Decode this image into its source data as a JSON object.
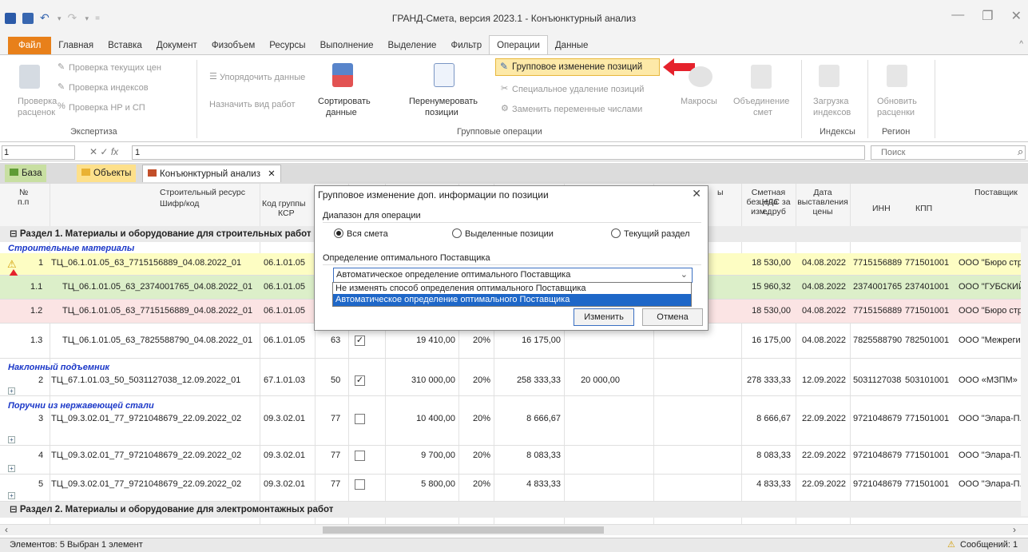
{
  "app": {
    "title": "ГРАНД-Смета, версия 2023.1 - Конъюнктурный анализ"
  },
  "menu": [
    "Файл",
    "Главная",
    "Вставка",
    "Документ",
    "Физобъем",
    "Ресурсы",
    "Выполнение",
    "Выделение",
    "Фильтр",
    "Операции",
    "Данные"
  ],
  "ribbon": {
    "check_prices": "Проверка текущих цен",
    "check_indexes": "Проверка индексов",
    "check_np": "Проверка НР и СП",
    "check_rates_1": "Проверка",
    "check_rates_2": "расценок",
    "group_expertise": "Экспертиза",
    "order_data": "Упорядочить данные",
    "assign_work": "Назначить вид работ",
    "sort_1": "Сортировать",
    "sort_2": "данные",
    "renumber_1": "Перенумеровать",
    "renumber_2": "позиции",
    "group_change": "Групповое изменение позиций",
    "special_delete": "Специальное удаление позиций",
    "replace_vars": "Заменить переменные числами",
    "group_ops": "Групповые операции",
    "macros": "Макросы",
    "merge_1": "Объединение",
    "merge_2": "смет",
    "load_1": "Загрузка",
    "load_2": "индексов",
    "group_indexes": "Индексы",
    "update_1": "Обновить",
    "update_2": "расценки",
    "group_region": "Регион"
  },
  "formula": {
    "cell": "1",
    "value": "1",
    "search_placeholder": "Поиск"
  },
  "tabs": {
    "base": "База",
    "objects": "Объекты",
    "analysis": "Конъюнктурный анализ"
  },
  "headers": {
    "num_1": "№",
    "num_2": "п.п",
    "resource": "Строительный ресурс",
    "code": "Шифр/код",
    "ksr_1": "Код группы",
    "ksr_2": "КСР",
    "units": "ы",
    "price_1": "Сметная цена",
    "price_2": "без НДС за ед.",
    "price_3": "изм., руб",
    "date_1": "Дата",
    "date_2": "выставления",
    "date_3": "цены",
    "supplier": "Поставщик",
    "inn": "ИНН",
    "kpp": "КПП"
  },
  "sections": {
    "s1": "Раздел 1. Материалы и оборудование для строительных работ",
    "s2": "Раздел 2. Материалы и оборудование для электромонтажных работ"
  },
  "groups": {
    "g1": "Строительные материалы",
    "g2": "Наклонный подъемник",
    "g3": "Поручни из нержавеющей стали"
  },
  "rows": [
    {
      "n": "1",
      "code": "ТЦ_06.1.01.05_63_7715156889_04.08.2022_01",
      "ksr": "06.1.01.05",
      "price": "18 530,00",
      "date": "04.08.2022",
      "inn": "7715156889",
      "kpp": "771501001",
      "sup": "ООО \"Бюро стр"
    },
    {
      "n": "1.1",
      "code": "ТЦ_06.1.01.05_63_2374001765_04.08.2022_01",
      "ksr": "06.1.01.05",
      "price": "15 960,32",
      "date": "04.08.2022",
      "inn": "2374001765",
      "kpp": "237401001",
      "sup": "ООО \"ГУБСКИЙ"
    },
    {
      "n": "1.2",
      "code": "ТЦ_06.1.01.05_63_7715156889_04.08.2022_01",
      "ksr": "06.1.01.05",
      "price": "18 530,00",
      "date": "04.08.2022",
      "inn": "7715156889",
      "kpp": "771501001",
      "sup": "ООО \"Бюро стр"
    },
    {
      "n": "1.3",
      "code": "ТЦ_06.1.01.05_63_7825588790_04.08.2022_01",
      "ksr": "06.1.01.05",
      "qty": "63",
      "p1": "19 410,00",
      "vat": "20%",
      "p2": "16 175,00",
      "price": "16 175,00",
      "date": "04.08.2022",
      "inn": "7825588790",
      "kpp": "782501001",
      "sup": "ООО \"Межреги"
    },
    {
      "n": "2",
      "code": "ТЦ_67.1.01.03_50_5031127038_12.09.2022_01",
      "ksr": "67.1.01.03",
      "qty": "50",
      "p1": "310 000,00",
      "vat": "20%",
      "p2": "258 333,33",
      "p3": "20 000,00",
      "price": "278 333,33",
      "date": "12.09.2022",
      "inn": "5031127038",
      "kpp": "503101001",
      "sup": "ООО «МЗПМ»"
    },
    {
      "n": "3",
      "code": "ТЦ_09.3.02.01_77_9721048679_22.09.2022_02",
      "ksr": "09.3.02.01",
      "qty": "77",
      "p1": "10 400,00",
      "vat": "20%",
      "p2": "8 666,67",
      "price": "8 666,67",
      "date": "22.09.2022",
      "inn": "9721048679",
      "kpp": "771501001",
      "sup": "ООО \"Элара-П."
    },
    {
      "n": "4",
      "code": "ТЦ_09.3.02.01_77_9721048679_22.09.2022_02",
      "ksr": "09.3.02.01",
      "qty": "77",
      "p1": "9 700,00",
      "vat": "20%",
      "p2": "8 083,33",
      "price": "8 083,33",
      "date": "22.09.2022",
      "inn": "9721048679",
      "kpp": "771501001",
      "sup": "ООО \"Элара-П."
    },
    {
      "n": "5",
      "code": "ТЦ_09.3.02.01_77_9721048679_22.09.2022_02",
      "ksr": "09.3.02.01",
      "qty": "77",
      "p1": "5 800,00",
      "vat": "20%",
      "p2": "4 833,33",
      "price": "4 833,33",
      "date": "22.09.2022",
      "inn": "9721048679",
      "kpp": "771501001",
      "sup": "ООО \"Элара-П."
    }
  ],
  "dialog": {
    "title": "Групповое изменение доп. информации по позиции",
    "range_label": "Диапазон для операции",
    "opt_all": "Вся смета",
    "opt_selected": "Выделенные позиции",
    "opt_section": "Текущий раздел",
    "supplier_label": "Определение оптимального Поставщика",
    "selected": "Автоматическое определение оптимального Поставщика",
    "options": [
      "Не изменять способ определения оптимального Поставщика",
      "Автоматическое определение оптимального Поставщика"
    ],
    "ok": "Изменить",
    "cancel": "Отмена"
  },
  "status": {
    "left": "Элементов: 5  Выбран 1 элемент",
    "right": "Сообщений: 1"
  },
  "colors": {
    "accent": "#e8801a",
    "highlight": "#fde9a8",
    "row_yellow": "#fdfdc3",
    "row_green": "#dcefc9",
    "row_pink": "#fbe4e4",
    "selection": "#1e67c8",
    "arrow": "#e5222c"
  }
}
